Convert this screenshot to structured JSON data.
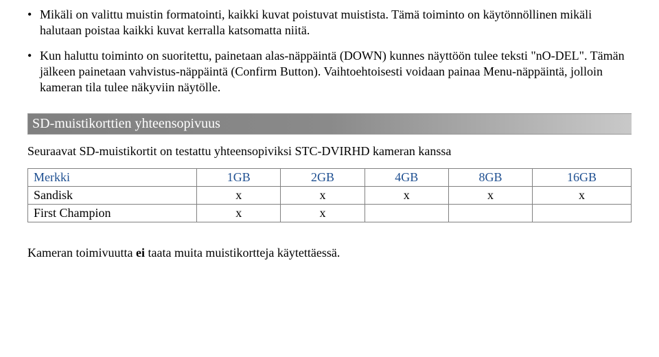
{
  "bullets": {
    "b1": {
      "dot": "•",
      "text": "Mikäli on valittu muistin formatointi, kaikki kuvat poistuvat muistista. Tämä toiminto on käytönnöllinen mikäli halutaan poistaa kaikki kuvat kerralla katsomatta niitä."
    },
    "b2": {
      "dot": "•",
      "text": "Kun haluttu toiminto on suoritettu, painetaan alas-näppäintä (DOWN) kunnes näyttöön tulee teksti \"nO-DEL\". Tämän jälkeen painetaan vahvistus-näppäintä (Confirm Button). Vaihtoehtoisesti voidaan painaa Menu-näppäintä, jolloin kameran tila tulee näkyviin näytölle."
    }
  },
  "section_title": "SD-muistikorttien yhteensopivuus",
  "intro": "Seuraavat SD-muistikortit on testattu yhteensopiviksi STC-DVIRHD kameran kanssa",
  "table": {
    "headers": {
      "brand": "Merkki",
      "c1": "1GB",
      "c2": "2GB",
      "c3": "4GB",
      "c4": "8GB",
      "c5": "16GB"
    },
    "rows": [
      {
        "brand": "Sandisk",
        "c1": "x",
        "c2": "x",
        "c3": "x",
        "c4": "x",
        "c5": "x"
      },
      {
        "brand": "First Champion",
        "c1": "x",
        "c2": "x",
        "c3": "",
        "c4": "",
        "c5": ""
      }
    ]
  },
  "footer": {
    "pre": "Kameran toimivuutta ",
    "bold": "ei",
    "post": " taata muita muistikortteja käytettäessä."
  }
}
